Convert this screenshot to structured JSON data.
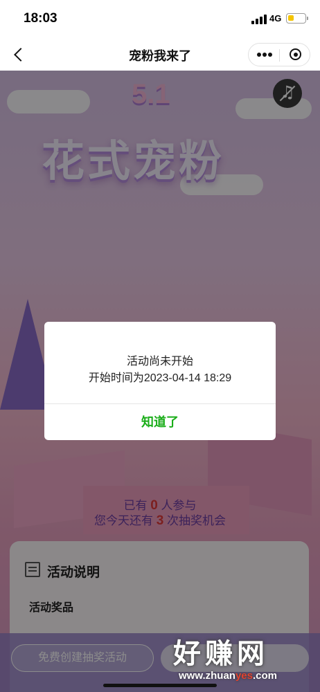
{
  "status_bar": {
    "time": "18:03",
    "network": "4G",
    "battery_level": 0.35,
    "battery_color": "#f4c400"
  },
  "nav": {
    "title": "宠粉我来了"
  },
  "hero": {
    "number": "5.1",
    "title": "花式宠粉"
  },
  "stats": {
    "joined_prefix": "已有",
    "joined_count": "0",
    "joined_suffix": "人参与",
    "chances_prefix": "您今天还有",
    "chances_count": "3",
    "chances_suffix": "次抽奖机会"
  },
  "info": {
    "title": "活动说明",
    "prize_label": "活动奖品"
  },
  "bottom": {
    "create_label": "免费创建抽奖活动"
  },
  "watermark": {
    "text": "好赚网",
    "url_prefix": "www.zhuan",
    "url_accent": "yes",
    "url_suffix": ".com"
  },
  "dialog": {
    "line1": "活动尚未开始",
    "line2": "开始时间为2023-04-14 18:29",
    "confirm_label": "知道了",
    "confirm_color": "#1aad19"
  }
}
